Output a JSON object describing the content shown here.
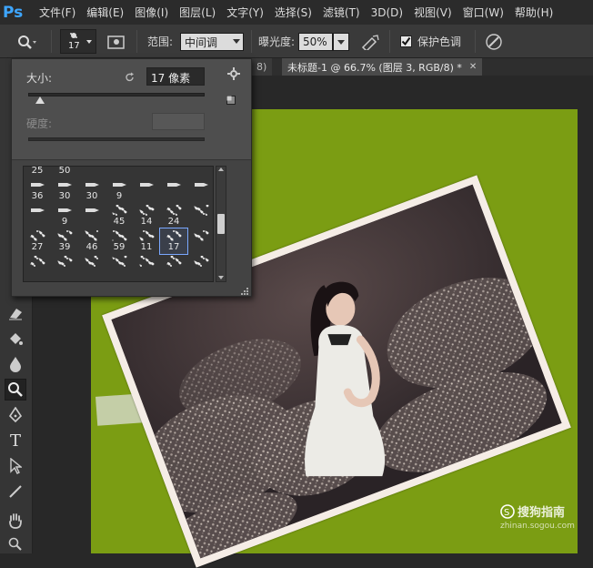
{
  "app": {
    "logo": "Ps"
  },
  "menu": [
    "文件(F)",
    "编辑(E)",
    "图像(I)",
    "图层(L)",
    "文字(Y)",
    "选择(S)",
    "滤镜(T)",
    "3D(D)",
    "视图(V)",
    "窗口(W)",
    "帮助(H)"
  ],
  "options": {
    "brush_size": "17",
    "range_label": "范围:",
    "range_value": "中间调",
    "exposure_label": "曝光度:",
    "exposure_value": "50%",
    "protect_label": "保护色调",
    "protect_checked": true
  },
  "tabs": [
    {
      "label": "8)"
    },
    {
      "label": "未标题-1 @ 66.7% (图层 3, RGB/8) *"
    }
  ],
  "brush_picker": {
    "size_label": "大小:",
    "size_value": "17 像素",
    "size_fraction": 0.06,
    "hardness_label": "硬度:",
    "hardness_value": "",
    "rows": [
      [
        "25",
        "50",
        "",
        "",
        "",
        "",
        ""
      ],
      [
        "36",
        "30",
        "30",
        "9",
        "",
        "",
        ""
      ],
      [
        "",
        "9",
        "",
        "45",
        "14",
        "24",
        ""
      ],
      [
        "27",
        "39",
        "46",
        "59",
        "11",
        "17",
        ""
      ],
      [
        "",
        "",
        "",
        "",
        "",
        "",
        ""
      ]
    ],
    "selected": "17"
  },
  "watermark": {
    "logo": "搜狗指南",
    "url": "zhinan.sogou.com"
  },
  "colors": {
    "canvas_green": "#7b9d13",
    "accent_blue": "#3ea6ff"
  }
}
